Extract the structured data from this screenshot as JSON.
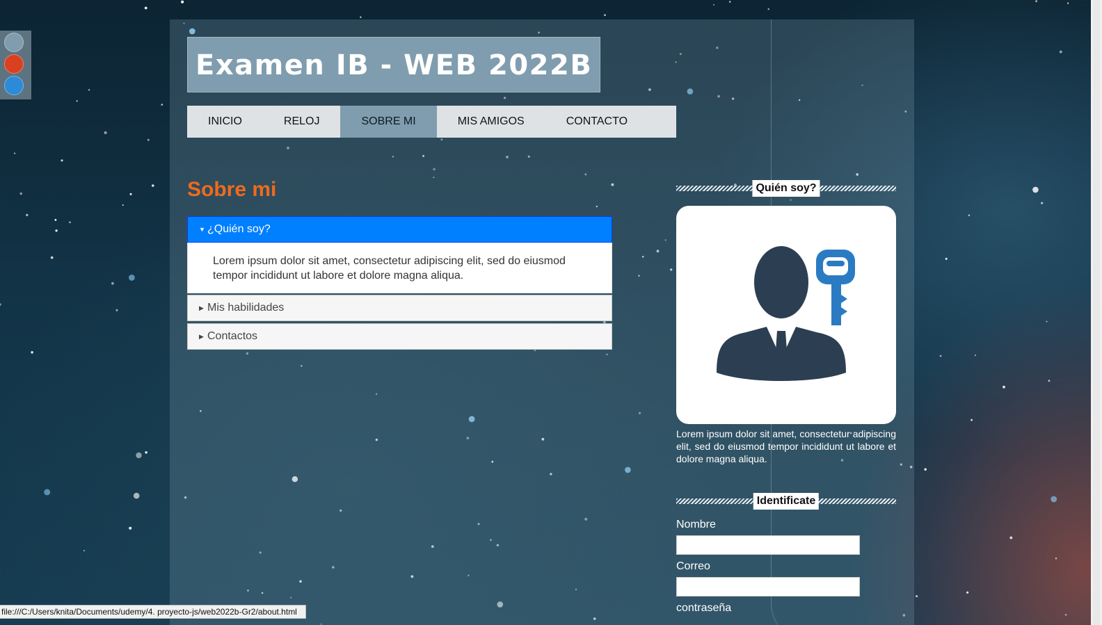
{
  "theme_switcher": {
    "colors": [
      "#7f9dae",
      "#d9401f",
      "#2c8ad6"
    ]
  },
  "header": {
    "title": "Examen IB - WEB 2022B"
  },
  "nav": {
    "items": [
      {
        "label": "Inicio"
      },
      {
        "label": "Reloj"
      },
      {
        "label": "Sobre mi",
        "active": true
      },
      {
        "label": "Mis amigos"
      },
      {
        "label": "Contacto"
      }
    ]
  },
  "main": {
    "heading": "Sobre mi",
    "accordion": [
      {
        "title": "¿Quién soy?",
        "expanded": true,
        "content": "Lorem ipsum dolor sit amet, consectetur adipiscing elit, sed do eiusmod tempor incididunt ut labore et dolore magna aliqua."
      },
      {
        "title": "Mis habilidades",
        "expanded": false
      },
      {
        "title": "Contactos",
        "expanded": false
      }
    ]
  },
  "sidebar": {
    "profile_heading": "Quién soy?",
    "profile_icon": "businessman-key-icon",
    "profile_text": "Lorem ipsum dolor sit amet, consectetur adipiscing elit, sed do eiusmod tempor incididunt ut labore et dolore magna aliqua.",
    "form_heading": "Identificate",
    "form": {
      "name_label": "Nombre",
      "email_label": "Correo",
      "password_label": "contraseña"
    }
  },
  "statusbar": {
    "url": "file:///C:/Users/knita/Documents/udemy/4. proyecto-js/web2022b-Gr2/about.html"
  }
}
